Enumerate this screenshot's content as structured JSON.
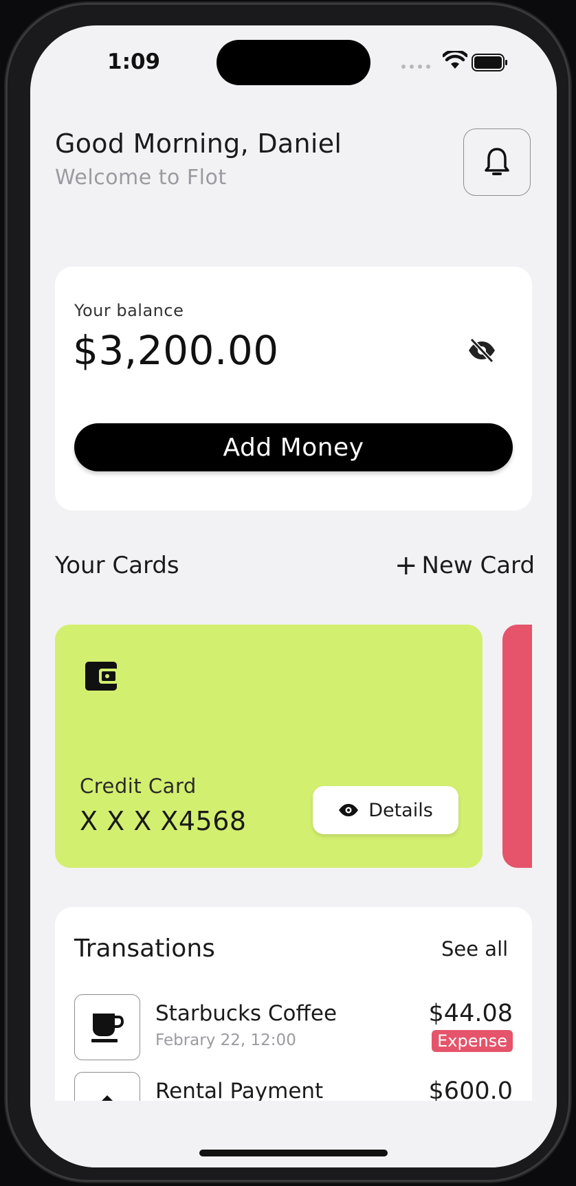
{
  "status_bar": {
    "time": "1:09"
  },
  "header": {
    "greeting": "Good Morning, Daniel",
    "subtitle": "Welcome to Flot"
  },
  "balance": {
    "label": "Your balance",
    "amount": "$3,200.00",
    "add_money_label": "Add Money"
  },
  "cards_section": {
    "title": "Your Cards",
    "new_card_label": "New Card",
    "cards": [
      {
        "type_label": "Credit Card",
        "number": "X X X X4568",
        "details_label": "Details",
        "color": "#d3ef6f"
      },
      {
        "color": "#e5546a"
      }
    ]
  },
  "transactions": {
    "title": "Transations",
    "see_all_label": "See all",
    "items": [
      {
        "name": "Starbucks Coffee",
        "date": "Febrary 22, 12:00",
        "amount": "$44.08",
        "badge": "Expense",
        "icon": "coffee-icon"
      },
      {
        "name": "Rental Payment",
        "amount": "$600.0",
        "icon": "arrow-up-icon"
      }
    ]
  }
}
